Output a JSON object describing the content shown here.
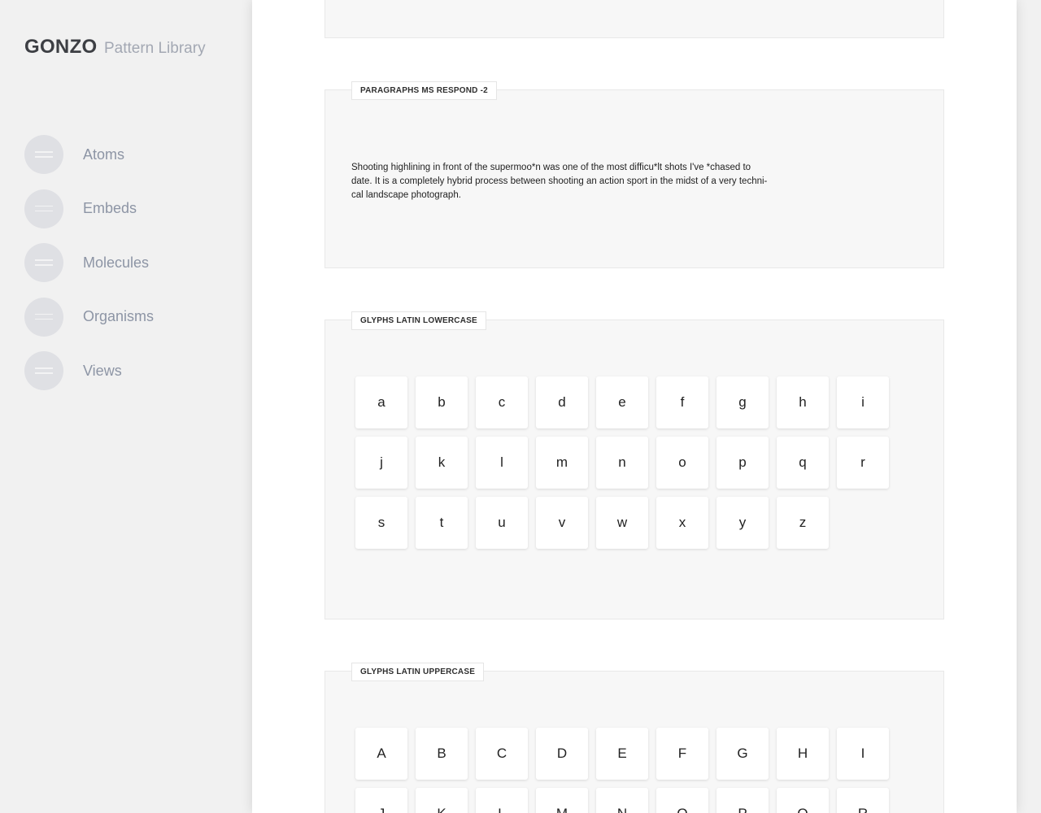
{
  "brand": {
    "name": "GONZO",
    "subtitle": "Pattern Library"
  },
  "nav": {
    "items": [
      {
        "label": "Atoms",
        "icon": "menu-icon"
      },
      {
        "label": "Embeds",
        "icon": "menu-icon"
      },
      {
        "label": "Molecules",
        "icon": "menu-icon"
      },
      {
        "label": "Organisms",
        "icon": "menu-icon"
      },
      {
        "label": "Views",
        "icon": "menu-icon"
      }
    ]
  },
  "sections": {
    "paragraphs": {
      "title": "PARAGRAPHS MS RESPOND -2",
      "lines": [
        "Shooting highlining in front of the supermoo*n was one of the most difficu*lt shots I've *chased to",
        "date. It is a completely hybrid process between shooting an action sport in the midst of a very techni-",
        "cal landscape photograph."
      ]
    },
    "lowercase": {
      "title": "GLYPHS LATIN LOWERCASE",
      "glyphs": [
        "a",
        "b",
        "c",
        "d",
        "e",
        "f",
        "g",
        "h",
        "i",
        "j",
        "k",
        "l",
        "m",
        "n",
        "o",
        "p",
        "q",
        "r",
        "s",
        "t",
        "u",
        "v",
        "w",
        "x",
        "y",
        "z"
      ]
    },
    "uppercase": {
      "title": "GLYPHS LATIN UPPERCASE",
      "glyphs": [
        "A",
        "B",
        "C",
        "D",
        "E",
        "F",
        "G",
        "H",
        "I",
        "J",
        "K",
        "L",
        "M",
        "N",
        "O",
        "P",
        "Q",
        "R"
      ]
    }
  },
  "colors": {
    "sidebar_bg": "#f1f1f1",
    "nav_label": "#8d95a5",
    "nav_icon_bg": "#dfe0e4",
    "panel_bg": "#f7f7f7",
    "brand": "#3d3f44"
  }
}
